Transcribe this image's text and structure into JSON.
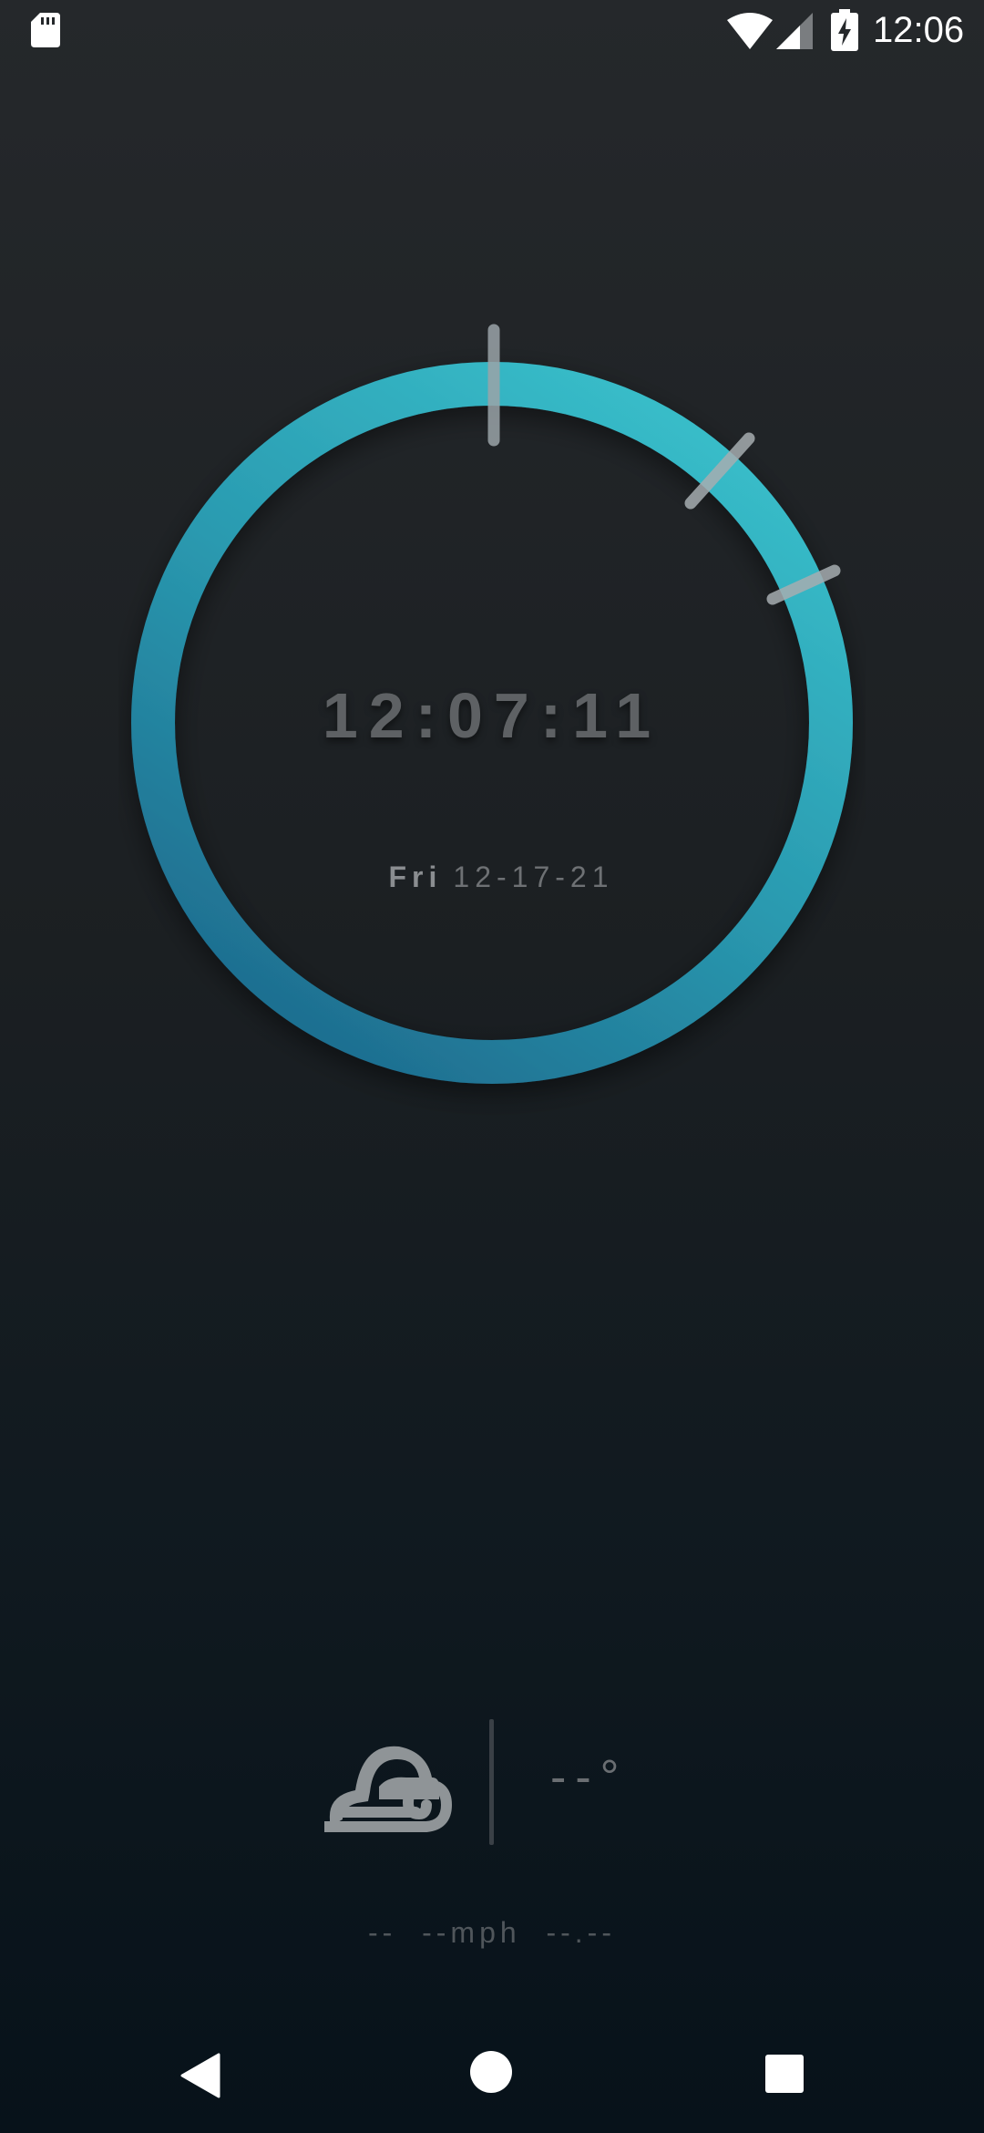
{
  "status_bar": {
    "time": "12:06",
    "icons": [
      "sd-card-icon",
      "wifi-icon",
      "cell-signal-icon",
      "battery-charging-icon"
    ]
  },
  "clock": {
    "time": "12:07:11",
    "day": "Fri",
    "date": "12-17-21",
    "ring_colors": {
      "top": "#38bcc9",
      "bottom": "#1e6e8f"
    }
  },
  "weather": {
    "icon": "cloud-wind-icon",
    "temperature": "--°",
    "details": "--  --mph  --.--"
  },
  "nav": {
    "icons": [
      "back-icon",
      "home-icon",
      "recents-icon"
    ]
  }
}
